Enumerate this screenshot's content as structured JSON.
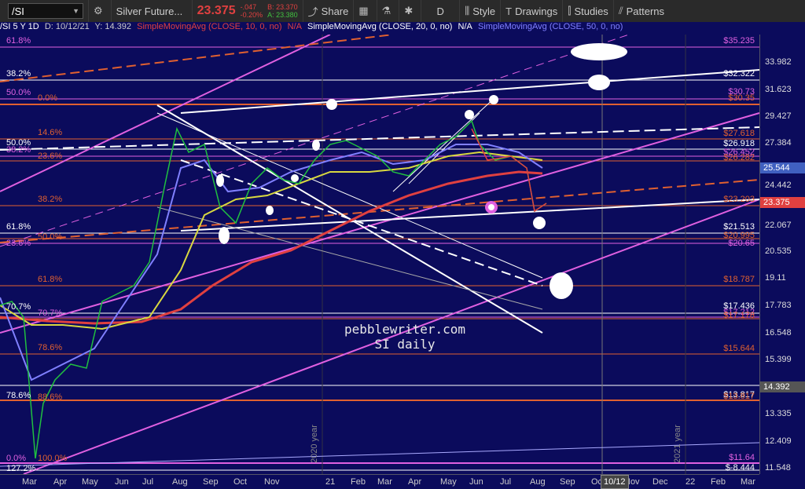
{
  "toolbar": {
    "symbol": "/SI",
    "description": "Silver Future...",
    "last": "23.375",
    "change": "-.047",
    "change_pct": "-0.20%",
    "bid": "B: 23.370",
    "ask": "A: 23.380",
    "share": "Share",
    "period": "D",
    "style": "Style",
    "drawings": "Drawings",
    "studies": "Studies",
    "patterns": "Patterns"
  },
  "studybar": {
    "symbol_info": "/SI 5 Y 1D",
    "date": "D: 10/12/21",
    "y": "Y: 14.392",
    "sma10": "SimpleMovingAvg (CLOSE, 10, 0, no)",
    "sma10_val": "N/A",
    "sma20": "SimpleMovingAvg (CLOSE, 20, 0, no)",
    "sma20_val": "N/A",
    "sma50": "SimpleMovingAvg (CLOSE, 50, 0, no)"
  },
  "colors": {
    "background": "#0b0b5c",
    "sma10": "#e04040",
    "sma20": "#d8d840",
    "sma50": "#8080ff",
    "fib_pink": "#e060e0",
    "fib_orange": "#e06030",
    "fib_white": "#ffffff"
  },
  "price_axis": [
    "33.982",
    "31.623",
    "29.427",
    "27.384",
    "24.442",
    "22.067",
    "20.535",
    "19.11",
    "17.783",
    "16.548",
    "15.399",
    "13.335",
    "12.409",
    "11.548"
  ],
  "price_tags": [
    {
      "value": "25.544",
      "color": "#4060c0"
    },
    {
      "value": "23.375",
      "color": "#e04040"
    },
    {
      "value": "14.392",
      "color": "#555555"
    }
  ],
  "time_axis": [
    "Mar",
    "Apr",
    "May",
    "Jun",
    "Jul",
    "Aug",
    "Sep",
    "Oct",
    "Nov",
    "21",
    "Feb",
    "Mar",
    "Apr",
    "May",
    "Jun",
    "Jul",
    "Aug",
    "Sep",
    "Oct",
    "Nov",
    "Dec",
    "22",
    "Feb",
    "Mar"
  ],
  "cursor_date": "10/12",
  "fib_left": [
    {
      "label": "61.8%",
      "color": "#e060e0"
    },
    {
      "label": "38.2%",
      "color": "#ffffff"
    },
    {
      "label": "50.0%",
      "color": "#e060e0"
    },
    {
      "label": "0.0%",
      "color": "#e06030"
    },
    {
      "label": "14.6%",
      "color": "#e06030"
    },
    {
      "label": "50.0%",
      "color": "#ffffff"
    },
    {
      "label": "38.2%",
      "color": "#e060e0"
    },
    {
      "label": "23.6%",
      "color": "#e06030"
    },
    {
      "label": "38.2%",
      "color": "#e06030"
    },
    {
      "label": "61.8%",
      "color": "#ffffff"
    },
    {
      "label": "50.0%",
      "color": "#e06030"
    },
    {
      "label": "23.6%",
      "color": "#e060e0"
    },
    {
      "label": "61.8%",
      "color": "#e06030"
    },
    {
      "label": "70.7%",
      "color": "#ffffff"
    },
    {
      "label": "70.7%",
      "color": "#e060e0"
    },
    {
      "label": "78.6%",
      "color": "#e06030"
    },
    {
      "label": "78.6%",
      "color": "#ffffff"
    },
    {
      "label": "88.6%",
      "color": "#e06030"
    },
    {
      "label": "0.0%",
      "color": "#e060e0"
    },
    {
      "label": "100.0%",
      "color": "#e06030"
    },
    {
      "label": "127.2%",
      "color": "#ffffff"
    }
  ],
  "right_levels": [
    {
      "value": "$35.235",
      "color": "#e060e0"
    },
    {
      "value": "$32.322",
      "color": "#ffffff"
    },
    {
      "value": "$30.73",
      "color": "#e060e0"
    },
    {
      "value": "$30.35",
      "color": "#e06030"
    },
    {
      "value": "$27.618",
      "color": "#e06030"
    },
    {
      "value": "$26.918",
      "color": "#ffffff"
    },
    {
      "value": "$26.452",
      "color": "#e060e0"
    },
    {
      "value": "$26.282",
      "color": "#e06030"
    },
    {
      "value": "$23.203",
      "color": "#e06030"
    },
    {
      "value": "$21.513",
      "color": "#ffffff"
    },
    {
      "value": "$20.995",
      "color": "#e06030"
    },
    {
      "value": "$20.65",
      "color": "#e060e0"
    },
    {
      "value": "$18.787",
      "color": "#e06030"
    },
    {
      "value": "$17.436",
      "color": "#ffffff"
    },
    {
      "value": "$17.212",
      "color": "#e060e0"
    },
    {
      "value": "$17.178",
      "color": "#e06030"
    },
    {
      "value": "$15.644",
      "color": "#e06030"
    },
    {
      "value": "$13.817",
      "color": "#ffffff"
    },
    {
      "value": "$13.817",
      "color": "#e06030"
    },
    {
      "value": "$11.64",
      "color": "#e060e0"
    },
    {
      "value": "$-8.444",
      "color": "#ffffff"
    }
  ],
  "vertical_labels": [
    "2020 year",
    "2021 year"
  ],
  "watermark": {
    "line1": "pebblewriter.com",
    "line2": "SI daily"
  }
}
